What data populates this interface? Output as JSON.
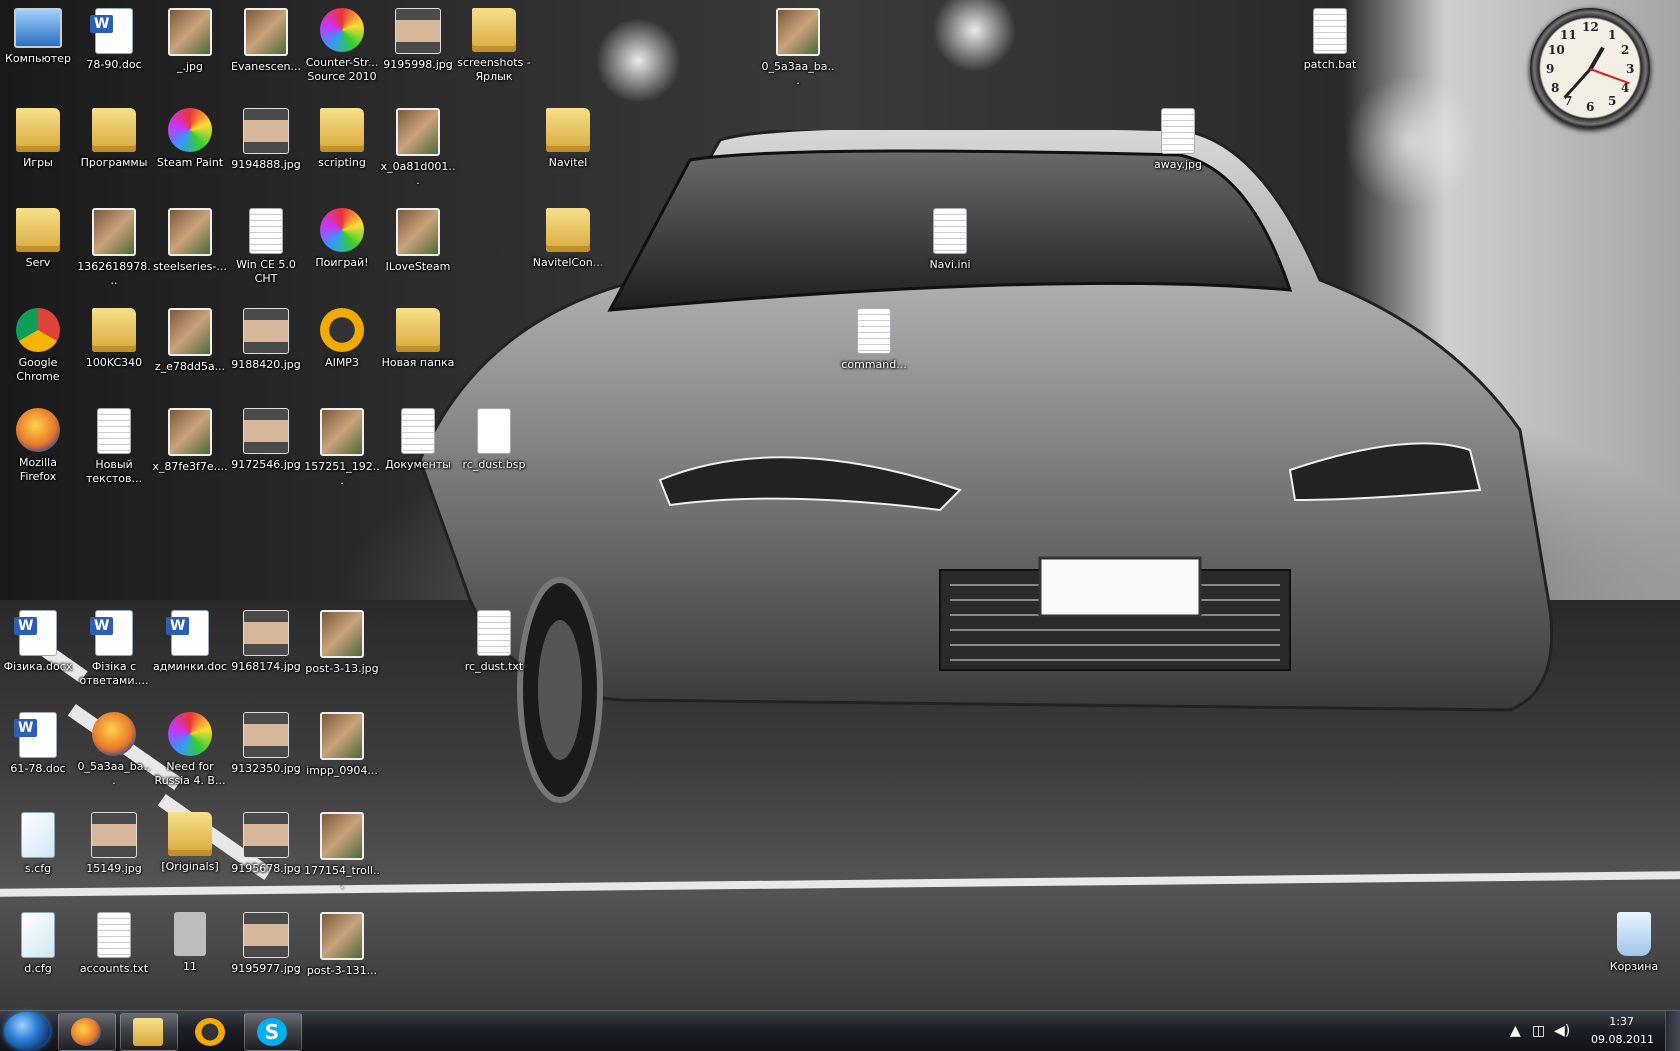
{
  "desktop_icons": [
    {
      "label": "Компьютер",
      "kind": "computer"
    },
    {
      "label": "78-90.doc",
      "kind": "doc"
    },
    {
      "label": "_.jpg",
      "kind": "img"
    },
    {
      "label": "Evanescen...",
      "kind": "img"
    },
    {
      "label": "Counter-Str... Source 2010",
      "kind": "app"
    },
    {
      "label": "9195998.jpg",
      "kind": "meme"
    },
    {
      "label": "screenshots - Ярлык",
      "kind": "folder"
    },
    {
      "label": "0_5a3aa_ba...",
      "kind": "img"
    },
    {
      "label": "patch.bat",
      "kind": "bat"
    },
    {
      "label": "Игры",
      "kind": "folder"
    },
    {
      "label": "Программы",
      "kind": "folder"
    },
    {
      "label": "Steam Paint",
      "kind": "app"
    },
    {
      "label": "9194888.jpg",
      "kind": "meme"
    },
    {
      "label": "scripting",
      "kind": "folder"
    },
    {
      "label": "x_0a81d001...",
      "kind": "img"
    },
    {
      "label": "Navitel",
      "kind": "folder"
    },
    {
      "label": "away.jpg",
      "kind": "jpg"
    },
    {
      "label": "Serv",
      "kind": "folder"
    },
    {
      "label": "1362618978...",
      "kind": "img"
    },
    {
      "label": "steelseries-...",
      "kind": "img"
    },
    {
      "label": "Win CE 5.0 CHT",
      "kind": "txt"
    },
    {
      "label": "Поиграй!",
      "kind": "app"
    },
    {
      "label": "ILoveSteam",
      "kind": "img"
    },
    {
      "label": "NavitelCon...",
      "kind": "folder"
    },
    {
      "label": "Navi.ini",
      "kind": "txt"
    },
    {
      "label": "Google Chrome",
      "kind": "chrome"
    },
    {
      "label": "100KC340",
      "kind": "folder"
    },
    {
      "label": "z_e78dd5a...",
      "kind": "img"
    },
    {
      "label": "9188420.jpg",
      "kind": "meme"
    },
    {
      "label": "AIMP3",
      "kind": "aimp"
    },
    {
      "label": "Новая папка",
      "kind": "folder"
    },
    {
      "label": "command...",
      "kind": "txt"
    },
    {
      "label": "Mozilla Firefox",
      "kind": "firefox"
    },
    {
      "label": "Новый текстов...",
      "kind": "txt"
    },
    {
      "label": "x_87fe3f7e....",
      "kind": "img"
    },
    {
      "label": "9172546.jpg",
      "kind": "meme"
    },
    {
      "label": "157251_192...",
      "kind": "img"
    },
    {
      "label": "Документы",
      "kind": "txt"
    },
    {
      "label": "rc_dust.bsp",
      "kind": "hl"
    },
    {
      "label": "Фізика.docx",
      "kind": "doc"
    },
    {
      "label": "Фізіка с ответами....",
      "kind": "doc"
    },
    {
      "label": "админки.doc",
      "kind": "doc"
    },
    {
      "label": "9168174.jpg",
      "kind": "meme"
    },
    {
      "label": "post-3-13.jpg",
      "kind": "img"
    },
    {
      "label": "rc_dust.txt",
      "kind": "txt"
    },
    {
      "label": "61-78.doc",
      "kind": "doc"
    },
    {
      "label": "0_5a3aa_ba...",
      "kind": "firefox"
    },
    {
      "label": "Need for Russia 4. В...",
      "kind": "app"
    },
    {
      "label": "9132350.jpg",
      "kind": "meme"
    },
    {
      "label": "impp_0904...",
      "kind": "img"
    },
    {
      "label": "s.cfg",
      "kind": "cfg"
    },
    {
      "label": "15149.jpg",
      "kind": "meme"
    },
    {
      "label": "[Originals]",
      "kind": "folder"
    },
    {
      "label": "9195678.jpg",
      "kind": "meme"
    },
    {
      "label": "177154_troll...",
      "kind": "img"
    },
    {
      "label": "d.cfg",
      "kind": "cfg"
    },
    {
      "label": "accounts.txt",
      "kind": "txt"
    },
    {
      "label": "11",
      "kind": "gray"
    },
    {
      "label": "9195977.jpg",
      "kind": "meme"
    },
    {
      "label": "post-3-131...",
      "kind": "img"
    },
    {
      "label": "Корзина",
      "kind": "trash"
    }
  ],
  "clock_gadget": {
    "numbers": [
      "12",
      "1",
      "2",
      "3",
      "4",
      "5",
      "6",
      "7",
      "8",
      "9",
      "10",
      "11"
    ]
  },
  "taskbar": {
    "items": [
      {
        "name": "firefox",
        "color": "#e8772a"
      },
      {
        "name": "explorer",
        "color": "#e9c46a"
      },
      {
        "name": "aimp",
        "color": "#f2a900"
      },
      {
        "name": "skype",
        "color": "#00aff0"
      }
    ],
    "time": "1:37",
    "date": "09.08.2011"
  },
  "colors": {
    "accent": "#2b7fd4",
    "taskbar": "#1c1f25"
  }
}
